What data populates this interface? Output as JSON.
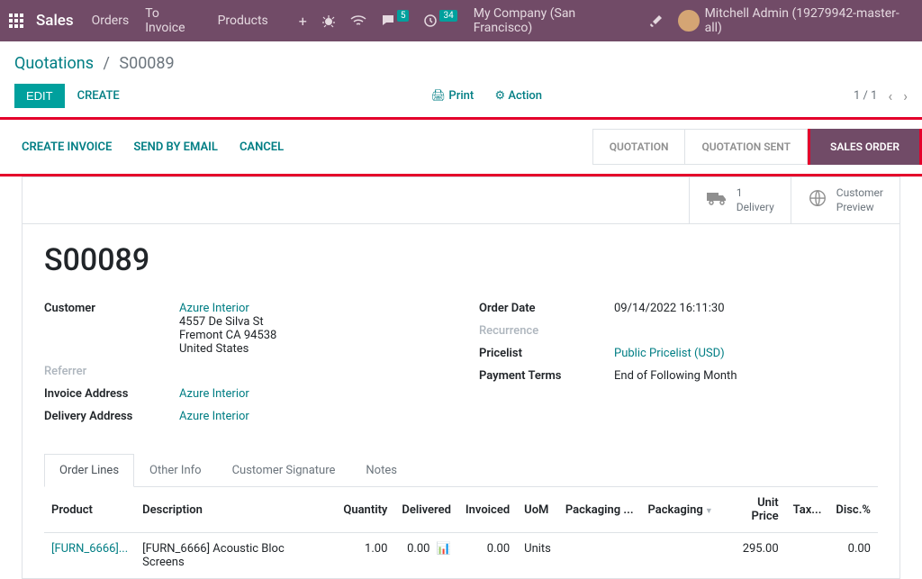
{
  "navbar": {
    "brand": "Sales",
    "links": [
      "Orders",
      "To Invoice",
      "Products"
    ],
    "messages_badge": "5",
    "activities_badge": "34",
    "company": "My Company (San Francisco)",
    "user": "Mitchell Admin (19279942-master-all)"
  },
  "breadcrumb": {
    "root": "Quotations",
    "current": "S00089"
  },
  "controls": {
    "edit": "EDIT",
    "create": "CREATE",
    "print": "Print",
    "action": "Action",
    "pager": "1 / 1"
  },
  "actions": {
    "create_invoice": "CREATE INVOICE",
    "send_email": "SEND BY EMAIL",
    "cancel": "CANCEL"
  },
  "status": {
    "quotation": "QUOTATION",
    "quotation_sent": "QUOTATION SENT",
    "sales_order": "SALES ORDER"
  },
  "stat_buttons": {
    "delivery_count": "1",
    "delivery_label": "Delivery",
    "preview_label1": "Customer",
    "preview_label2": "Preview"
  },
  "order": {
    "name": "S00089",
    "labels": {
      "customer": "Customer",
      "referrer": "Referrer",
      "invoice_addr": "Invoice Address",
      "delivery_addr": "Delivery Address",
      "order_date": "Order Date",
      "recurrence": "Recurrence",
      "pricelist": "Pricelist",
      "payment_terms": "Payment Terms"
    },
    "customer": "Azure Interior",
    "addr1": "4557 De Silva St",
    "addr2": "Fremont CA 94538",
    "addr3": "United States",
    "invoice_addr": "Azure Interior",
    "delivery_addr": "Azure Interior",
    "order_date": "09/14/2022 16:11:30",
    "pricelist": "Public Pricelist (USD)",
    "payment_terms": "End of Following Month"
  },
  "tabs": {
    "order_lines": "Order Lines",
    "other_info": "Other Info",
    "signature": "Customer Signature",
    "notes": "Notes"
  },
  "table": {
    "headers": {
      "product": "Product",
      "description": "Description",
      "quantity": "Quantity",
      "delivered": "Delivered",
      "invoiced": "Invoiced",
      "uom": "UoM",
      "packaging_qty": "Packaging ...",
      "packaging": "Packaging",
      "unit_price": "Unit Price",
      "taxes": "Tax...",
      "disc": "Disc.%"
    },
    "rows": [
      {
        "product": "[FURN_6666]...",
        "description": "[FURN_6666] Acoustic Bloc Screens",
        "quantity": "1.00",
        "delivered": "0.00",
        "invoiced": "0.00",
        "uom": "Units",
        "unit_price": "295.00",
        "disc": "0.00"
      }
    ]
  }
}
